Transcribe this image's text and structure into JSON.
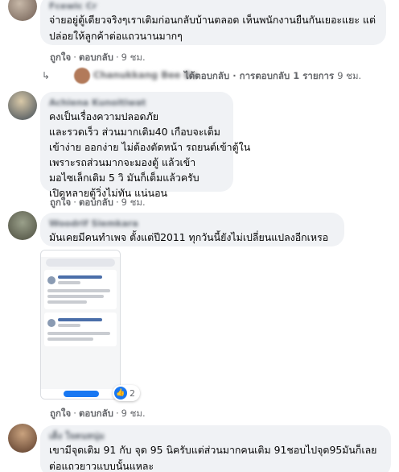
{
  "actions": {
    "like": "ถูกใจ",
    "reply": "ตอบกลับ",
    "dot": "·"
  },
  "comments": [
    {
      "author": "Fcewic Cr",
      "lines": [
        "จ่ายอยู่ตู้เดียวจริงๆเราเติมก่อนกลับบ้านตลอด เห็นพนักงานยืนกันเยอะแยะ แต่",
        "ปล่อยให้ลูกค้าต่อแถวนานมากๆ"
      ],
      "time": "9 ชม."
    },
    {
      "author": "Achiena Kunoitiwat",
      "lines": [
        "คงเป็นเรื่องความปลอดภัย",
        "และรวดเร็ว ส่วนมากเติม40 เกือบจะเต็ม",
        "เข้าง่าย ออกง่าย ไม่ต้องตัดหน้า รถยนต์เข้าตู้ใน",
        "เพราะรถส่วนมากจะมองตู้ แล้วเข้า",
        "มอไซเล็กเติม 5 วิ มันก็เต็มแล้วครับ",
        "เปิดหลายตู้วิ่งไม่ทัน แน่นอน"
      ],
      "time": "9 ชม."
    },
    {
      "author": "Woodrif Siemkara",
      "lines": [
        "มันเคยมีคนทำเพจ ตั้งแต่ปี2011 ทุกวันนี้ยังไม่เปลี่ยนแปลงอีกเหรอ"
      ],
      "time": "9 ชม."
    },
    {
      "author": "เต็ง ใจคนหนุ่ม",
      "lines": [
        "เขามีจุดเติม 91 กับ จุด 95 นิครับแต่ส่วนมากคนเติม 91ชอบไปจุด95มันก็เลย",
        "ต่อแถวยาวแบบนั้นแหละ"
      ]
    }
  ],
  "reply_row": {
    "name": "Chanukkang Bee Do",
    "tail": "ได้ตอบกลับ · การตอบกลับ 1 รายการ",
    "time": "9 ชม."
  },
  "reaction": {
    "icon": "like-icon",
    "count": "2"
  },
  "colors": {
    "bubble": "#f0f2f5",
    "meta": "#65676b",
    "accent": "#1877f2"
  }
}
